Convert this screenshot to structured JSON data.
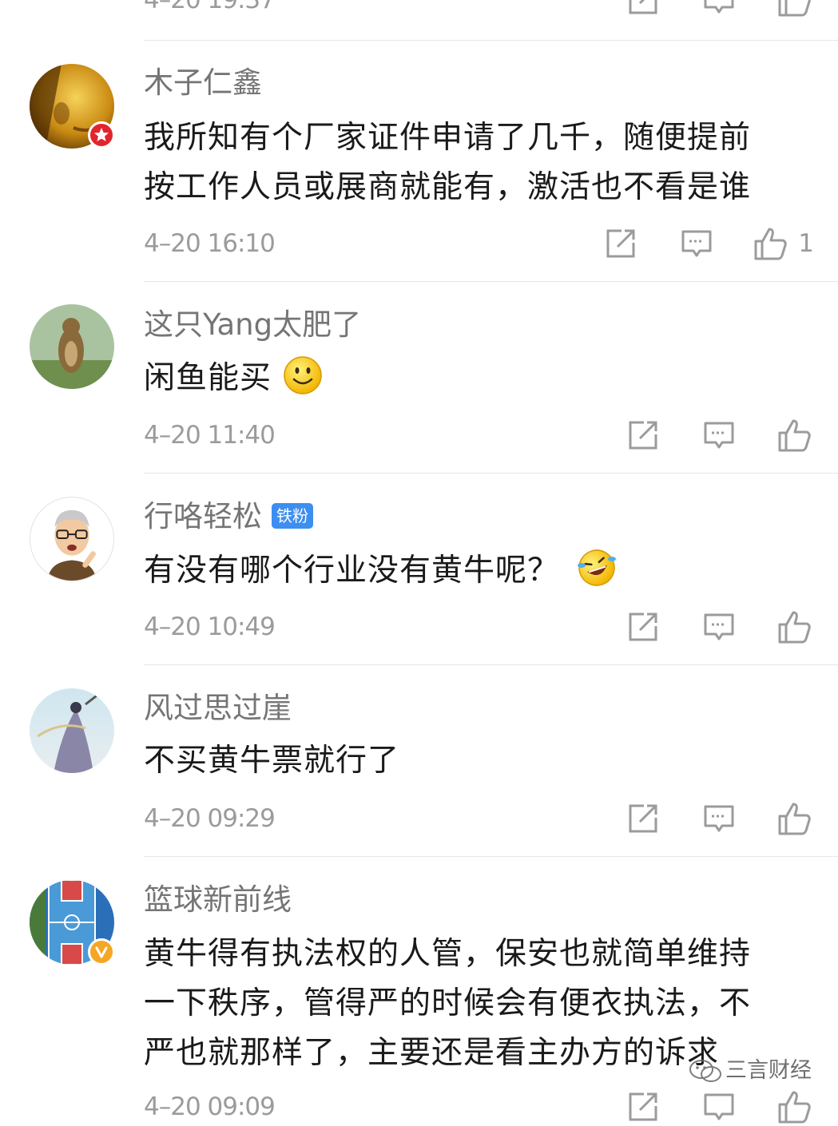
{
  "top_partial": {
    "time": "4–20 19:37"
  },
  "comments": [
    {
      "username": "木子仁鑫",
      "lines": [
        "我所知有个厂家证件申请了几千，随便提前",
        "按工作人员或展商就能有，激活也不看是谁"
      ],
      "time": "4–20 16:10",
      "likes": "1",
      "badge": "red-star-badge"
    },
    {
      "username": "这只Yang太肥了",
      "lines": [
        "闲鱼能买"
      ],
      "emoji": "smile-emoji",
      "time": "4–20 11:40"
    },
    {
      "username": "行咯轻松",
      "fan_badge": "铁粉",
      "lines": [
        "有没有哪个行业没有黄牛呢？"
      ],
      "emoji": "laugh-cry-emoji",
      "time": "4–20 10:49"
    },
    {
      "username": "风过思过崖",
      "lines": [
        "不买黄牛票就行了"
      ],
      "time": "4–20 09:29"
    },
    {
      "username": "篮球新前线",
      "lines": [
        "黄牛得有执法权的人管，保安也就简单维持",
        "一下秩序，管得严的时候会有便衣执法，不",
        "严也就那样了，主要还是看主办方的诉求"
      ],
      "time": "4–20 09:09",
      "badge": "verified-v-badge"
    }
  ],
  "watermark": {
    "text": "三言财经"
  },
  "colors": {
    "divider": "#e6e6e6",
    "meta": "#9b9b9b",
    "username": "#757575",
    "text": "#1a1a1a",
    "fan_badge": "#3d8ef0"
  }
}
